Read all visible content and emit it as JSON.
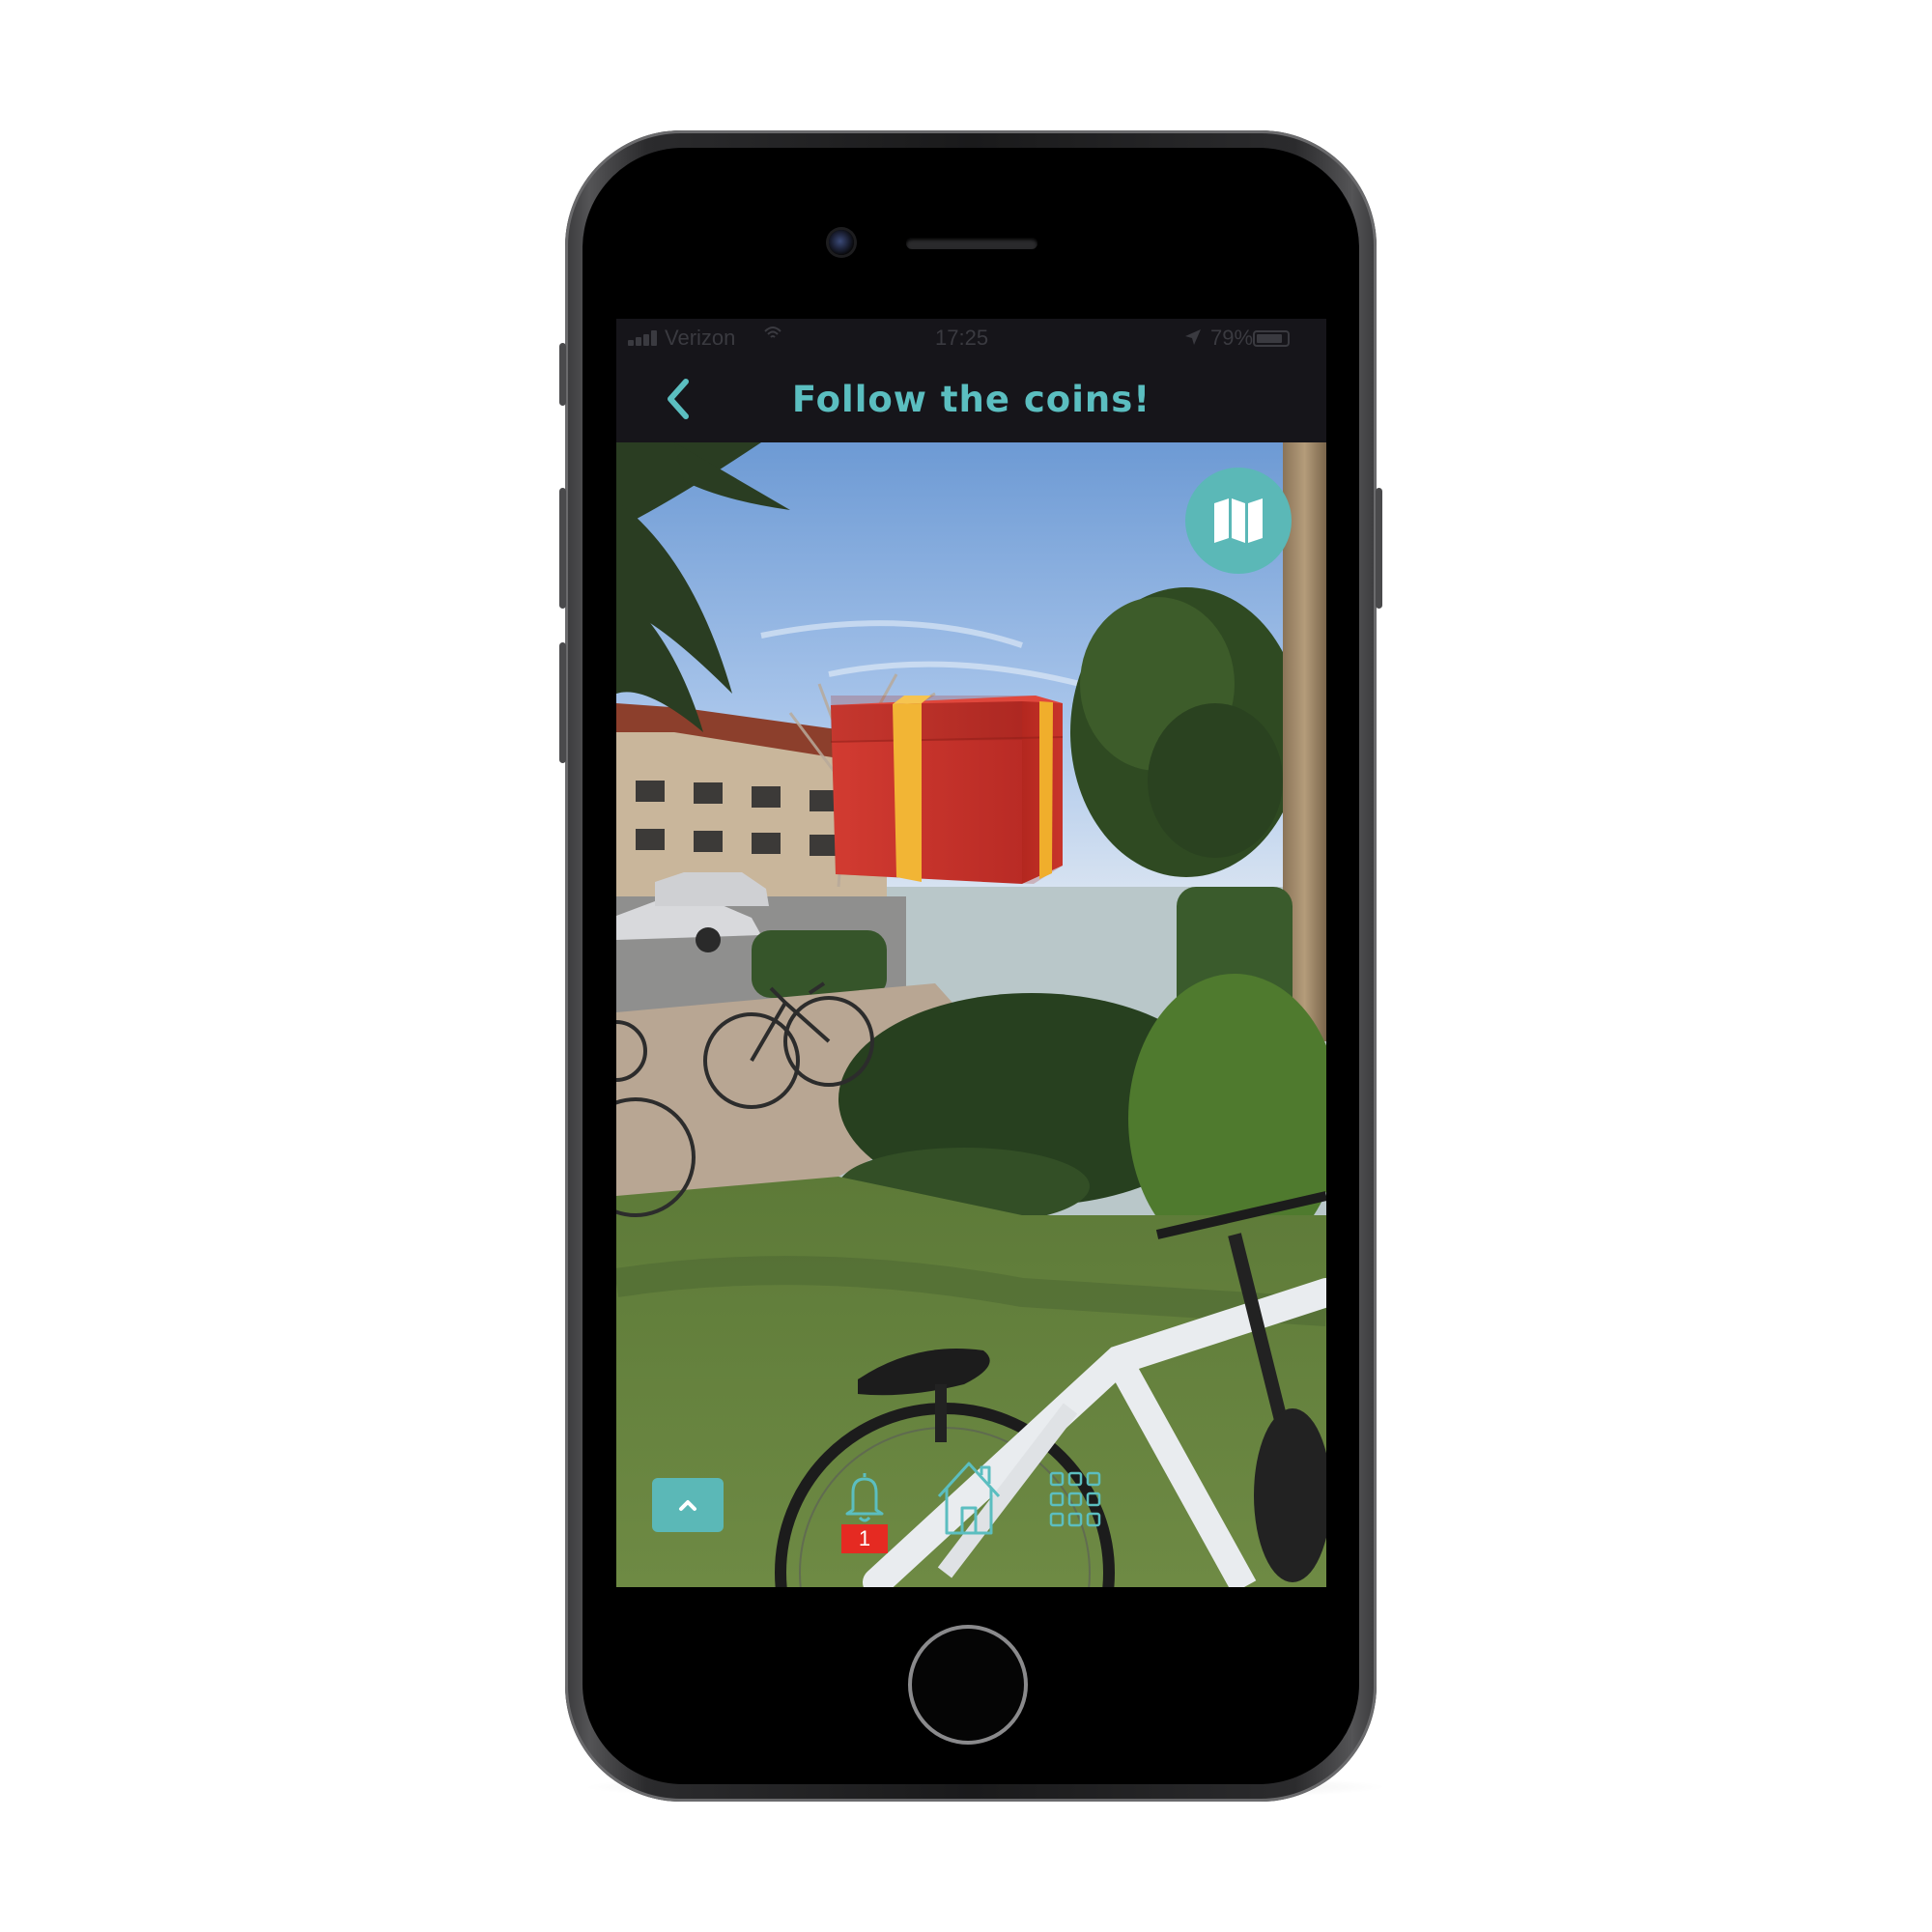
{
  "status_bar": {
    "carrier": "Verizon",
    "time": "17:25",
    "battery": "79%"
  },
  "nav": {
    "title": "Follow the coins!"
  },
  "toolbar": {
    "notification_count": "1"
  },
  "icons": {
    "back": "chevron-left-icon",
    "map": "map-icon",
    "expand": "chevron-up-icon",
    "notifications": "bell-icon",
    "home": "home-icon",
    "grid": "grid-icon"
  },
  "colors": {
    "accent": "#5bbec0",
    "badge": "#e52a22",
    "gift_red": "#c9302c",
    "gift_ribbon": "#f2b535"
  }
}
